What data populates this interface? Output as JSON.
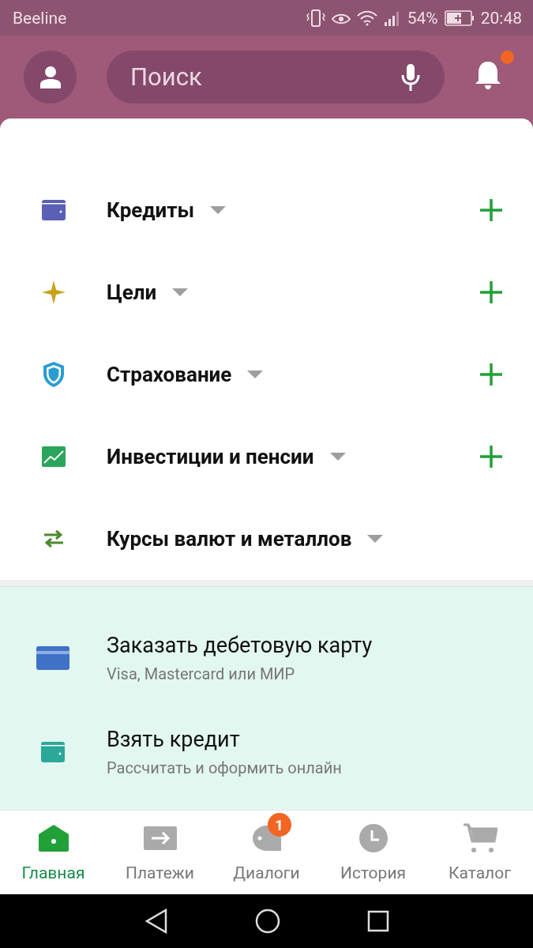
{
  "status_bar": {
    "carrier": "Beeline",
    "battery": "54%",
    "time": "20:48"
  },
  "header": {
    "search": {
      "placeholder": "Поиск"
    },
    "notifications": {
      "unread": true
    }
  },
  "sections": [
    {
      "title": "Кредиты",
      "expanded": false,
      "addable": true
    },
    {
      "title": "Цели",
      "expanded": false,
      "addable": true
    },
    {
      "title": "Страхование",
      "expanded": false,
      "addable": true
    },
    {
      "title": "Инвестиции и пенсии",
      "expanded": false,
      "addable": true
    },
    {
      "title": "Курсы валют и металлов",
      "expanded": false,
      "addable": false
    }
  ],
  "offers": [
    {
      "title": "Заказать дебетовую карту",
      "subtitle": "Visa, Mastercard или МИР"
    },
    {
      "title": "Взять кредит",
      "subtitle": "Рассчитать и оформить онлайн"
    }
  ],
  "tabs": [
    {
      "label": "Главная",
      "selected": true
    },
    {
      "label": "Платежи",
      "selected": false
    },
    {
      "label": "Диалоги",
      "selected": false,
      "badge": "1"
    },
    {
      "label": "История",
      "selected": false
    },
    {
      "label": "Каталог",
      "selected": false
    }
  ]
}
